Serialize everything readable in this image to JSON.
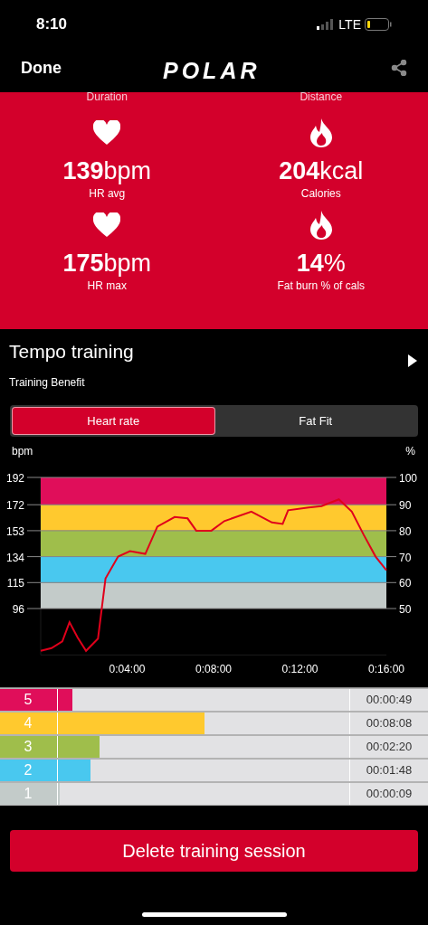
{
  "status_bar": {
    "time": "8:10",
    "network": "LTE"
  },
  "nav": {
    "done": "Done",
    "logo": "POLAR"
  },
  "stats_header": [
    "Duration",
    "Distance"
  ],
  "stats": [
    {
      "kind": "heart",
      "value": "**139**bpm",
      "label": "HR avg"
    },
    {
      "kind": "flame",
      "value": "**204**kcal",
      "label": "Calories"
    },
    {
      "kind": "heart",
      "value": "**175**bpm",
      "label": "HR max"
    },
    {
      "kind": "flame",
      "value": "**14**%",
      "label": "Fat burn % of cals"
    }
  ],
  "session": {
    "title": "Tempo training",
    "subtitle": "Training Benefit"
  },
  "tabs": [
    {
      "label": "Heart rate",
      "selected": true
    },
    {
      "label": "Fat Fit",
      "selected": false
    }
  ],
  "chart": {
    "ylabel": "bpm",
    "y2label": "%",
    "y2ticks": [
      "100",
      "90",
      "80",
      "70",
      "60",
      "50"
    ],
    "chart_data": {
      "type": "line",
      "grid": true,
      "bands": [
        {
          "axis": "y",
          "from": 172,
          "to": 192,
          "color": "#e00e5a"
        },
        {
          "axis": "y",
          "from": 153,
          "to": 172,
          "color": "#ffc92e"
        },
        {
          "axis": "y",
          "from": 134,
          "to": 153,
          "color": "#9fbe4b"
        },
        {
          "axis": "y",
          "from": 115,
          "to": 134,
          "color": "#49c8ef"
        },
        {
          "axis": "y",
          "from": 96,
          "to": 115,
          "color": "#c3cbc9"
        }
      ],
      "x": [
        0,
        0.5,
        1,
        1.33,
        1.7,
        2.1,
        2.65,
        3.0,
        3.58,
        4.13,
        4.84,
        5.4,
        6.2,
        6.8,
        7.2,
        7.9,
        8.5,
        9.75,
        10.7,
        11.2,
        11.45,
        12.4,
        13,
        13.8,
        14.4,
        14.95,
        15.5,
        16
      ],
      "series": [
        {
          "color": "#e0001b",
          "values": [
            65,
            67,
            72,
            86,
            75,
            65,
            74,
            118,
            134,
            138,
            136,
            156,
            163,
            162,
            153,
            153,
            160,
            167,
            159,
            158,
            168,
            170,
            171,
            176,
            167,
            150,
            134,
            124
          ]
        }
      ],
      "xticks": [
        {
          "value": 4,
          "label": "0:04:00"
        },
        {
          "value": 8,
          "label": "0:08:00"
        },
        {
          "value": 12,
          "label": "0:12:00"
        },
        {
          "value": 16,
          "label": "0:16:00"
        }
      ],
      "xlim": [
        0,
        16
      ],
      "ylim": [
        62,
        192
      ],
      "yticks": [
        {
          "value": 192,
          "label": "192"
        },
        {
          "value": 172,
          "label": "172"
        },
        {
          "value": 153,
          "label": "153"
        },
        {
          "value": 134,
          "label": "134"
        },
        {
          "value": 115,
          "label": "115"
        },
        {
          "value": 96,
          "label": "96"
        }
      ]
    }
  },
  "zones": [
    {
      "zone": "5",
      "color": "#e00e5a",
      "level": 0.207,
      "time": "00:00:49"
    },
    {
      "zone": "4",
      "color": "#ffc92e",
      "level": 0.585,
      "time": "00:08:08"
    },
    {
      "zone": "3",
      "color": "#9fbe4b",
      "level": 0.285,
      "time": "00:02:20"
    },
    {
      "zone": "2",
      "color": "#49c8ef",
      "level": 0.259,
      "time": "00:01:48"
    },
    {
      "zone": "1",
      "color": "#c3cbc9",
      "level": 0.171,
      "time": "00:00:09"
    }
  ],
  "delete_button": "Delete training session"
}
